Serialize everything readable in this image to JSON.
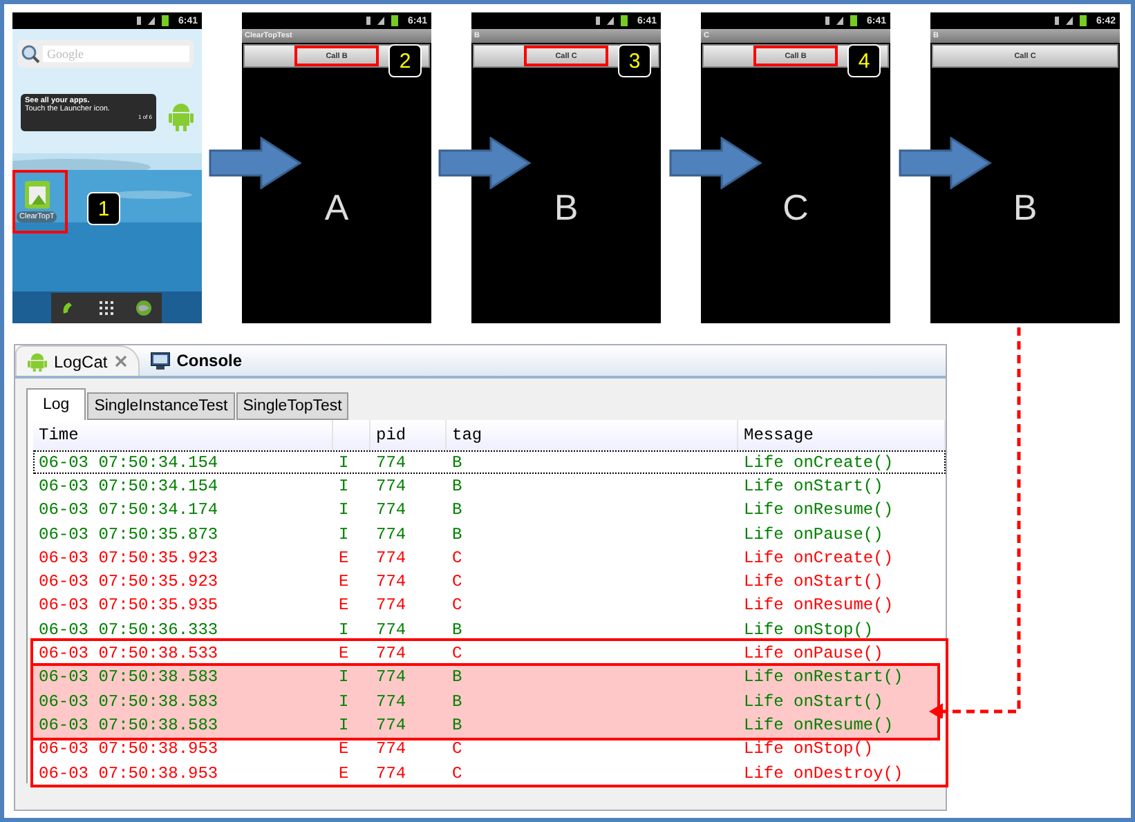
{
  "screens": [
    {
      "kind": "home",
      "time": "6:41",
      "search_placeholder": "Google",
      "tip_title": "See all your apps.",
      "tip_text": "Touch the Launcher icon.",
      "tip_page": "1 of 6",
      "app_label": "ClearTopT",
      "step": "1",
      "highlight": true
    },
    {
      "kind": "activity",
      "time": "6:41",
      "title": "ClearTopTest",
      "button": "Call B",
      "letter": "A",
      "step": "2",
      "highlight": true
    },
    {
      "kind": "activity",
      "time": "6:41",
      "title": "B",
      "button": "Call C",
      "letter": "B",
      "step": "3",
      "highlight": true
    },
    {
      "kind": "activity",
      "time": "6:41",
      "title": "C",
      "button": "Call B",
      "letter": "C",
      "step": "4",
      "highlight": true
    },
    {
      "kind": "activity",
      "time": "6:42",
      "title": "B",
      "button": "Call C",
      "letter": "B",
      "highlight": false
    }
  ],
  "view_tabs": [
    {
      "label": "LogCat",
      "selected": true,
      "kind": "logcat"
    },
    {
      "label": "Console",
      "selected": false,
      "kind": "console"
    }
  ],
  "log_tabs": [
    {
      "label": "Log",
      "selected": true
    },
    {
      "label": "SingleInstanceTest",
      "selected": false
    },
    {
      "label": "SingleTopTest",
      "selected": false
    }
  ],
  "table": {
    "columns": [
      "Time",
      "",
      "pid",
      "tag",
      "Message"
    ],
    "rows": [
      {
        "time": "06-03 07:50:34.154",
        "level": "I",
        "pid": "774",
        "tag": "B",
        "message": "Life onCreate()",
        "color": "#008000",
        "selected": true,
        "boxed": false,
        "highlighted": false
      },
      {
        "time": "06-03 07:50:34.154",
        "level": "I",
        "pid": "774",
        "tag": "B",
        "message": "Life onStart()",
        "color": "#008000",
        "selected": false,
        "boxed": false,
        "highlighted": false
      },
      {
        "time": "06-03 07:50:34.174",
        "level": "I",
        "pid": "774",
        "tag": "B",
        "message": "Life onResume()",
        "color": "#008000",
        "selected": false,
        "boxed": false,
        "highlighted": false
      },
      {
        "time": "06-03 07:50:35.873",
        "level": "I",
        "pid": "774",
        "tag": "B",
        "message": "Life onPause()",
        "color": "#008000",
        "selected": false,
        "boxed": false,
        "highlighted": false
      },
      {
        "time": "06-03 07:50:35.923",
        "level": "E",
        "pid": "774",
        "tag": "C",
        "message": "Life onCreate()",
        "color": "#ff0000",
        "selected": false,
        "boxed": false,
        "highlighted": false
      },
      {
        "time": "06-03 07:50:35.923",
        "level": "E",
        "pid": "774",
        "tag": "C",
        "message": "Life onStart()",
        "color": "#ff0000",
        "selected": false,
        "boxed": false,
        "highlighted": false
      },
      {
        "time": "06-03 07:50:35.935",
        "level": "E",
        "pid": "774",
        "tag": "C",
        "message": "Life onResume()",
        "color": "#ff0000",
        "selected": false,
        "boxed": false,
        "highlighted": false
      },
      {
        "time": "06-03 07:50:36.333",
        "level": "I",
        "pid": "774",
        "tag": "B",
        "message": "Life onStop()",
        "color": "#008000",
        "selected": false,
        "boxed": false,
        "highlighted": false
      },
      {
        "time": "06-03 07:50:38.533",
        "level": "E",
        "pid": "774",
        "tag": "C",
        "message": "Life onPause()",
        "color": "#ff0000",
        "selected": false,
        "boxed": true,
        "highlighted": false
      },
      {
        "time": "06-03 07:50:38.583",
        "level": "I",
        "pid": "774",
        "tag": "B",
        "message": "Life onRestart()",
        "color": "#008000",
        "selected": false,
        "boxed": true,
        "highlighted": true
      },
      {
        "time": "06-03 07:50:38.583",
        "level": "I",
        "pid": "774",
        "tag": "B",
        "message": "Life onStart()",
        "color": "#008000",
        "selected": false,
        "boxed": true,
        "highlighted": true
      },
      {
        "time": "06-03 07:50:38.583",
        "level": "I",
        "pid": "774",
        "tag": "B",
        "message": "Life onResume()",
        "color": "#008000",
        "selected": false,
        "boxed": true,
        "highlighted": true
      },
      {
        "time": "06-03 07:50:38.953",
        "level": "E",
        "pid": "774",
        "tag": "C",
        "message": "Life onStop()",
        "color": "#ff0000",
        "selected": false,
        "boxed": true,
        "highlighted": false
      },
      {
        "time": "06-03 07:50:38.953",
        "level": "E",
        "pid": "774",
        "tag": "C",
        "message": "Life onDestroy()",
        "color": "#ff0000",
        "selected": false,
        "boxed": true,
        "highlighted": false
      }
    ]
  }
}
